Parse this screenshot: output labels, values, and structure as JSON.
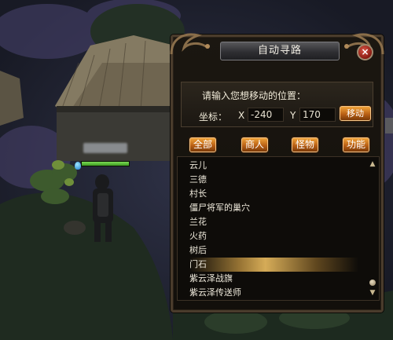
{
  "dialog": {
    "title": "自动寻路",
    "close_icon": "×",
    "prompt": "请输入您想移动的位置：",
    "coord_label": "坐标：",
    "x_label": "X",
    "x_value": "-240",
    "y_label": "Y",
    "y_value": "170",
    "move_button": "移动",
    "filters": [
      "全部",
      "商人",
      "怪物",
      "功能"
    ],
    "list_items": [
      "云儿",
      "三德",
      "村长",
      "僵尸将军的巢穴",
      "兰花",
      "火药",
      "树后",
      "门石",
      "紫云泽战旗",
      "紫云泽传送师"
    ],
    "selected_index": 7
  },
  "player": {
    "hp_fraction": 1.0
  },
  "colors": {
    "button_orange": "#d07a22",
    "panel_border": "#4a3c2c",
    "title_text": "#f4f0e6"
  },
  "icons": {
    "close": "close-icon",
    "scroll_up": "scroll-up-icon",
    "scroll_down": "scroll-down-icon"
  }
}
